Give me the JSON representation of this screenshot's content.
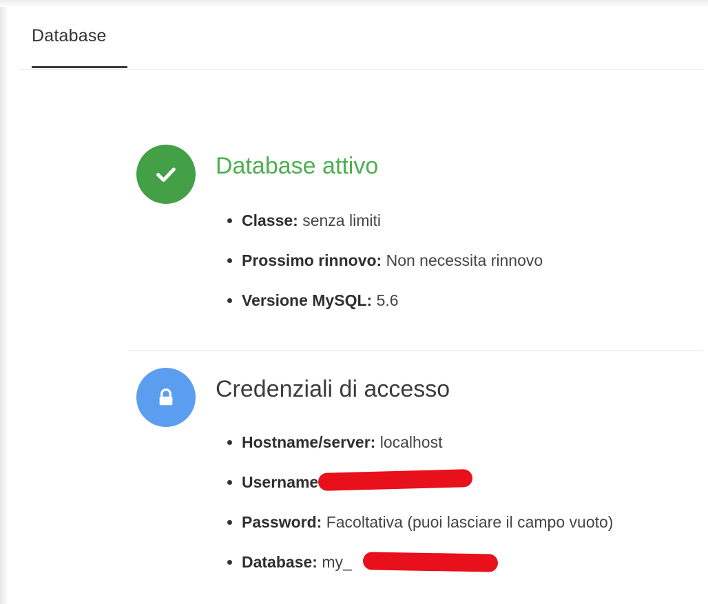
{
  "tabs": [
    {
      "label": "Database",
      "active": true
    }
  ],
  "colors": {
    "success": "#4caf50",
    "success_badge": "#43a047",
    "info_badge": "#5b9ef0",
    "redaction": "#e8101a"
  },
  "status_section": {
    "icon": "check-icon",
    "title": "Database attivo",
    "items": [
      {
        "key": "Classe:",
        "value": "senza limiti"
      },
      {
        "key": "Prossimo rinnovo:",
        "value": "Non necessita rinnovo"
      },
      {
        "key": "Versione MySQL:",
        "value": "5.6"
      }
    ]
  },
  "credentials_section": {
    "icon": "lock-icon",
    "title": "Credenziali di accesso",
    "items": [
      {
        "key": "Hostname/server:",
        "value": "localhost"
      },
      {
        "key": "Username",
        "value": ""
      },
      {
        "key": "Password:",
        "value": "Facoltativa (puoi lasciare il campo vuoto)"
      },
      {
        "key": "Database:",
        "value": "my_"
      }
    ]
  }
}
